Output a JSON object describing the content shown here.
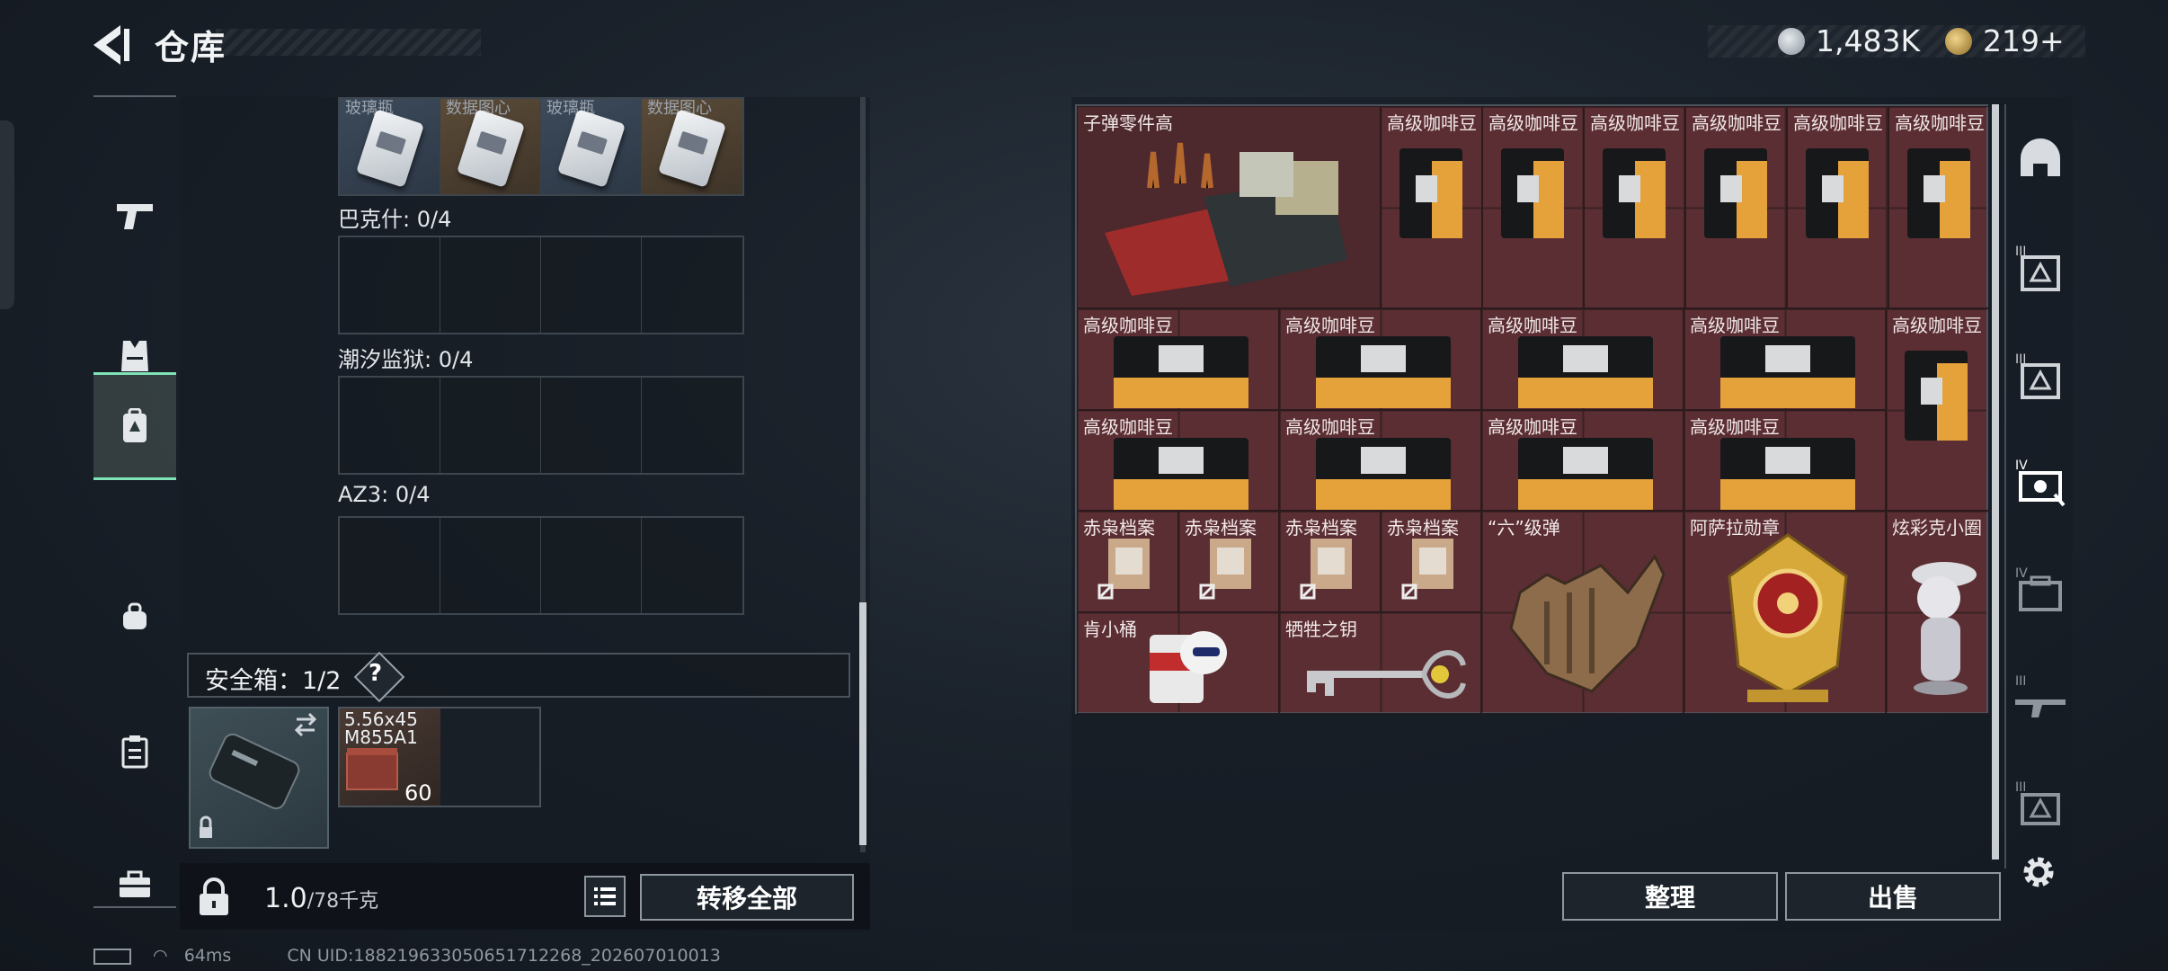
{
  "header": {
    "title": "仓库"
  },
  "currency": [
    {
      "icon": "silver-coin-icon",
      "value": "1,483K",
      "color": "#b7bec6"
    },
    {
      "icon": "gold-coin-icon",
      "value": "219",
      "suffix": "+",
      "color": "#c9a54a"
    }
  ],
  "left_nav": {
    "items": [
      "pistol-icon",
      "vest-icon",
      "backpack-locked-icon",
      "bag-icon",
      "clipboard-icon",
      "toolbox-icon"
    ],
    "active_index": 2
  },
  "collection": {
    "top_row_labels": [
      "玻璃瓶",
      "数据图心",
      "玻璃瓶",
      "数据图心"
    ],
    "zones": [
      {
        "label": "巴克什: 0/4"
      },
      {
        "label": "潮汐监狱: 0/4"
      },
      {
        "label": "AZ3: 0/4"
      }
    ]
  },
  "safe_box": {
    "label": "安全箱：1/2",
    "help": "?",
    "ammo_name": "5.56x45 M855A1",
    "ammo_qty": "60"
  },
  "bottom_left": {
    "weight": "1.0",
    "weight_limit": "/78千克",
    "transfer_all": "转移全部"
  },
  "stash": {
    "items": [
      {
        "name": "子弹零件高",
        "kind": "parts-crate"
      },
      {
        "name": "高级咖啡豆",
        "kind": "coffee-bag"
      },
      {
        "name": "高级咖啡豆",
        "kind": "coffee-bag"
      },
      {
        "name": "高级咖啡豆",
        "kind": "coffee-bag"
      },
      {
        "name": "高级咖啡豆",
        "kind": "coffee-bag"
      },
      {
        "name": "高级咖啡豆",
        "kind": "coffee-bag"
      },
      {
        "name": "高级咖啡豆",
        "kind": "coffee-bag"
      },
      {
        "name": "高级咖啡豆",
        "kind": "coffee-bag-flat"
      },
      {
        "name": "高级咖啡豆",
        "kind": "coffee-bag-flat"
      },
      {
        "name": "高级咖啡豆",
        "kind": "coffee-bag-flat"
      },
      {
        "name": "高级咖啡豆",
        "kind": "coffee-bag-flat"
      },
      {
        "name": "高级咖啡豆",
        "kind": "coffee-bag"
      },
      {
        "name": "高级咖啡豆",
        "kind": "coffee-bag-flat"
      },
      {
        "name": "高级咖啡豆",
        "kind": "coffee-bag-flat"
      },
      {
        "name": "高级咖啡豆",
        "kind": "coffee-bag-flat"
      },
      {
        "name": "高级咖啡豆",
        "kind": "coffee-bag-flat"
      },
      {
        "name": "赤枭档案",
        "kind": "dossier"
      },
      {
        "name": "赤枭档案",
        "kind": "dossier"
      },
      {
        "name": "赤枭档案",
        "kind": "dossier"
      },
      {
        "name": "赤枭档案",
        "kind": "dossier"
      },
      {
        "name": "“六”级弹",
        "kind": "bullet-hand"
      },
      {
        "name": "阿萨拉勋章",
        "kind": "medal"
      },
      {
        "name": "炫彩克小圈",
        "kind": "figurine"
      },
      {
        "name": "肯小桶",
        "kind": "bucket-mascot"
      },
      {
        "name": "牺牲之钥",
        "kind": "key"
      }
    ]
  },
  "right_actions": {
    "sort": "整理",
    "sell": "出售"
  },
  "right_nav": [
    "helmet-icon",
    "armor-tier3-icon",
    "armor-tier3-alt-icon",
    "armor-tier4-icon",
    "case-tier4-icon",
    "rifle-tier3-icon",
    "case-tier3-icon"
  ],
  "status_bar": {
    "ping": "64ms",
    "uid": "CN UID:18821963305065171226­8_202607010013"
  }
}
